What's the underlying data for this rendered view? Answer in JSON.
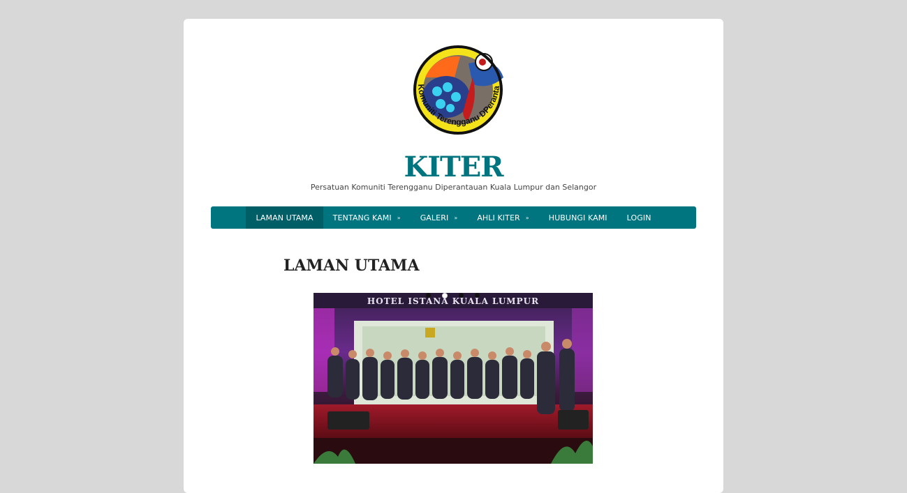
{
  "site": {
    "title": "KITER",
    "tagline": "Persatuan Komuniti Terengganu Diperantauan Kuala Lumpur dan Selangor",
    "logo_text": "Komuniti Terengganu DPerantauan",
    "brand_color": "#00757f"
  },
  "nav": {
    "items": [
      {
        "label": "LAMAN UTAMA",
        "active": true,
        "dropdown": false
      },
      {
        "label": "TENTANG KAMI",
        "active": false,
        "dropdown": true
      },
      {
        "label": "GALERI",
        "active": false,
        "dropdown": true
      },
      {
        "label": "AHLI KITER",
        "active": false,
        "dropdown": true
      },
      {
        "label": "HUBUNGI KAMI",
        "active": false,
        "dropdown": false
      },
      {
        "label": "LOGIN",
        "active": false,
        "dropdown": false
      }
    ],
    "caret": "»"
  },
  "main": {
    "heading": "LAMAN UTAMA",
    "slider": {
      "banner_text": "HOTEL ISTANA KUALA LUMPUR",
      "slides": 4,
      "active_slide": 2
    }
  }
}
